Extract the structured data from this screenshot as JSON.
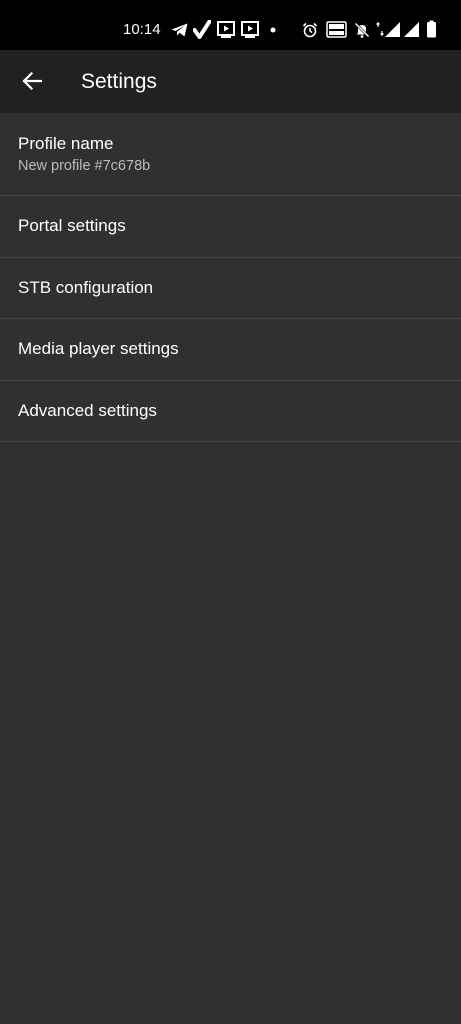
{
  "status_bar": {
    "time": "10:14",
    "icons": [
      "telegram-icon",
      "check-icon",
      "media-icon",
      "media-icon",
      "dot-icon",
      "alarm-icon",
      "volte-icon",
      "mute-icon",
      "network-4g-icon",
      "signal-icon",
      "signal-icon",
      "battery-icon"
    ]
  },
  "app_bar": {
    "title": "Settings",
    "back_icon": "arrow-back-icon"
  },
  "settings": {
    "items": [
      {
        "label": "Profile name",
        "subtitle": "New profile #7c678b"
      },
      {
        "label": "Portal settings"
      },
      {
        "label": "STB configuration"
      },
      {
        "label": "Media player settings"
      },
      {
        "label": "Advanced settings"
      }
    ]
  },
  "colors": {
    "background": "#303030",
    "app_bar": "#212121",
    "status_bar": "#000000",
    "divider": "#474747",
    "text_primary": "#ffffff",
    "text_secondary": "#bdbdbd"
  }
}
